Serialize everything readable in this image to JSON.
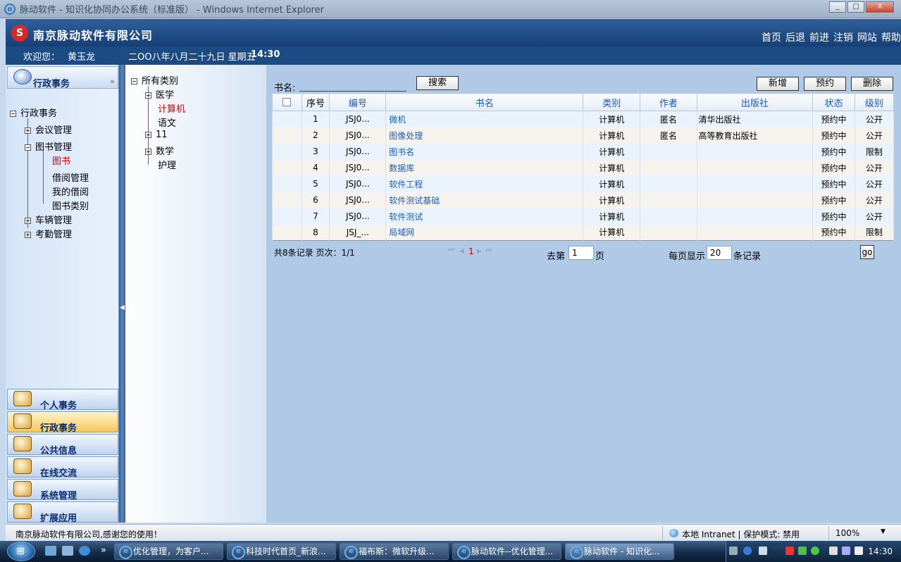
{
  "window": {
    "title": "脉动软件 - 知识化协同办公系统（标准版） - Windows Internet Explorer",
    "min": "_",
    "max": "□",
    "close": "X"
  },
  "header": {
    "logo": "S",
    "company": "南京脉动软件有限公司",
    "nav": [
      "首页",
      "后退",
      "前进",
      "注销",
      "网站",
      "帮助"
    ]
  },
  "welcome": {
    "label": "欢迎您：",
    "user": "黄玉龙",
    "date": "二OO八年八月二十九日 星期五",
    "time": "14:30"
  },
  "left": {
    "panel_title": "行政事务",
    "chevron": "»",
    "tree": {
      "root": "行政事务",
      "items": [
        "会议管理",
        "图书管理",
        "图书",
        "借阅管理",
        "我的借阅",
        "图书类别",
        "车辆管理",
        "考勤管理"
      ]
    },
    "modules": [
      "个人事务",
      "行政事务",
      "公共信息",
      "在线交流",
      "系统管理",
      "扩展应用"
    ]
  },
  "category": {
    "root": "所有类别",
    "items": [
      "医学",
      "计算机",
      "语文",
      "11",
      "数学",
      "护理"
    ]
  },
  "search": {
    "label": "书名:",
    "value": "",
    "button": "搜索"
  },
  "toolbar": {
    "add": "新增",
    "reserve": "预约",
    "delete": "删除"
  },
  "table": {
    "headers": [
      "序号",
      "编号",
      "书名",
      "类别",
      "作者",
      "出版社",
      "状态",
      "级别"
    ],
    "rows": [
      {
        "no": "1",
        "code": "JSJ0...",
        "name": "微机",
        "cat": "计算机",
        "author": "匿名",
        "pub": "清华出版社",
        "status": "预约中",
        "level": "公开"
      },
      {
        "no": "2",
        "code": "JSJ0...",
        "name": "图像处理",
        "cat": "计算机",
        "author": "匿名",
        "pub": "高等教育出版社",
        "status": "预约中",
        "level": "公开"
      },
      {
        "no": "3",
        "code": "JSJ0...",
        "name": "图书名",
        "cat": "计算机",
        "author": "",
        "pub": "",
        "status": "预约中",
        "level": "限制"
      },
      {
        "no": "4",
        "code": "JSJ0...",
        "name": "数据库",
        "cat": "计算机",
        "author": "",
        "pub": "",
        "status": "预约中",
        "level": "公开"
      },
      {
        "no": "5",
        "code": "JSJ0...",
        "name": "软件工程",
        "cat": "计算机",
        "author": "",
        "pub": "",
        "status": "预约中",
        "level": "公开"
      },
      {
        "no": "6",
        "code": "JSJ0...",
        "name": "软件测试基础",
        "cat": "计算机",
        "author": "",
        "pub": "",
        "status": "预约中",
        "level": "公开"
      },
      {
        "no": "7",
        "code": "JSJ0...",
        "name": "软件测试",
        "cat": "计算机",
        "author": "",
        "pub": "",
        "status": "预约中",
        "level": "公开"
      },
      {
        "no": "8",
        "code": "JSJ_...",
        "name": "局域网",
        "cat": "计算机",
        "author": "",
        "pub": "",
        "status": "预约中",
        "level": "限制"
      }
    ]
  },
  "pager": {
    "summary": "共8条记录 页次：1/1",
    "first": "⏮",
    "prev": "◀",
    "current": "1",
    "next": "▶",
    "last": "⏭",
    "goto_label": "去第",
    "goto_value": "1",
    "page_unit": "页",
    "per_page_label": "每页显示",
    "per_page_value": "20",
    "records_unit": "条记录",
    "go": "go"
  },
  "status": {
    "message": "南京脉动软件有限公司,感谢您的使用！",
    "zone": "本地 Intranet | 保护模式: 禁用",
    "zoom": "100%"
  },
  "taskbar": {
    "start": "⊞",
    "more": "»",
    "tasks": [
      "优化管理，为客户...",
      "科技时代首页_新浪...",
      "福布斯：微软升级...",
      "脉动软件--优化管理...",
      "脉动软件 - 知识化..."
    ],
    "clock": "14:30"
  }
}
